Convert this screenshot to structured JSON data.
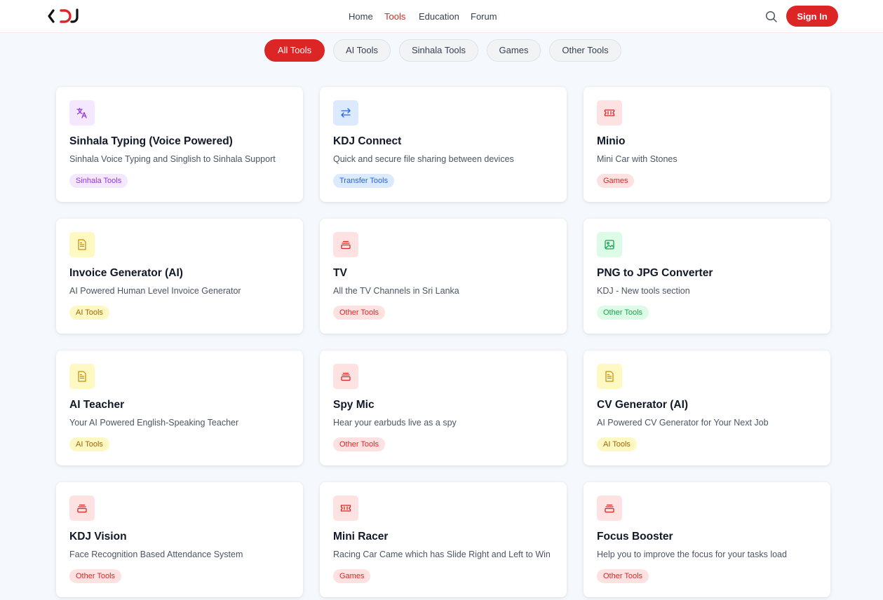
{
  "header": {
    "logo_text": "KDJ",
    "nav": [
      {
        "label": "Home"
      },
      {
        "label": "Tools"
      },
      {
        "label": "Education"
      },
      {
        "label": "Forum"
      }
    ],
    "active_nav": "Tools",
    "signin_label": "Sign In"
  },
  "filters": [
    {
      "label": "All Tools",
      "active": true
    },
    {
      "label": "AI Tools",
      "active": false
    },
    {
      "label": "Sinhala Tools",
      "active": false
    },
    {
      "label": "Games",
      "active": false
    },
    {
      "label": "Other Tools",
      "active": false
    }
  ],
  "tools": [
    {
      "title": "Sinhala Typing (Voice Powered)",
      "description": "Sinhala Voice Typing and Singlish to Sinhala Support",
      "tag": "Sinhala Tools",
      "icon": "translate-icon",
      "color": "#9333ea"
    },
    {
      "title": "KDJ Connect",
      "description": "Quick and secure file sharing between devices",
      "tag": "Transfer Tools",
      "icon": "transfer-arrows-icon",
      "color": "#2563eb"
    },
    {
      "title": "Minio",
      "description": "Mini Car with Stones",
      "tag": "Games",
      "icon": "ticket-icon",
      "color": "#dc2626"
    },
    {
      "title": "Invoice Generator (AI)",
      "description": "AI Powered Human Level Invoice Generator",
      "tag": "AI Tools",
      "icon": "document-icon",
      "color": "#ca8a04"
    },
    {
      "title": "TV",
      "description": "All the TV Channels in Sri Lanka",
      "tag": "Other Tools",
      "icon": "stack-icon",
      "color": "#dc2626"
    },
    {
      "title": "PNG to JPG Converter",
      "description": "KDJ - New tools section",
      "tag": "Other Tools",
      "icon": "image-icon",
      "color": "#16a34a"
    },
    {
      "title": "AI Teacher",
      "description": "Your AI Powered English-Speaking Teacher",
      "tag": "AI Tools",
      "icon": "document-icon",
      "color": "#ca8a04"
    },
    {
      "title": "Spy Mic",
      "description": "Hear your earbuds live as a spy",
      "tag": "Other Tools",
      "icon": "stack-icon",
      "color": "#dc2626"
    },
    {
      "title": "CV Generator (AI)",
      "description": "AI Powered CV Generator for Your Next Job",
      "tag": "AI Tools",
      "icon": "document-icon",
      "color": "#ca8a04"
    },
    {
      "title": "KDJ Vision",
      "description": "Face Recognition Based Attendance System",
      "tag": "Other Tools",
      "icon": "stack-icon",
      "color": "#dc2626"
    },
    {
      "title": "Mini Racer",
      "description": "Racing Car Came which has Slide Right and Left to Win",
      "tag": "Games",
      "icon": "ticket-icon",
      "color": "#dc2626"
    },
    {
      "title": "Focus Booster",
      "description": "Help you to improve the focus for your tasks load",
      "tag": "Other Tools",
      "icon": "stack-icon",
      "color": "#dc2626"
    }
  ]
}
